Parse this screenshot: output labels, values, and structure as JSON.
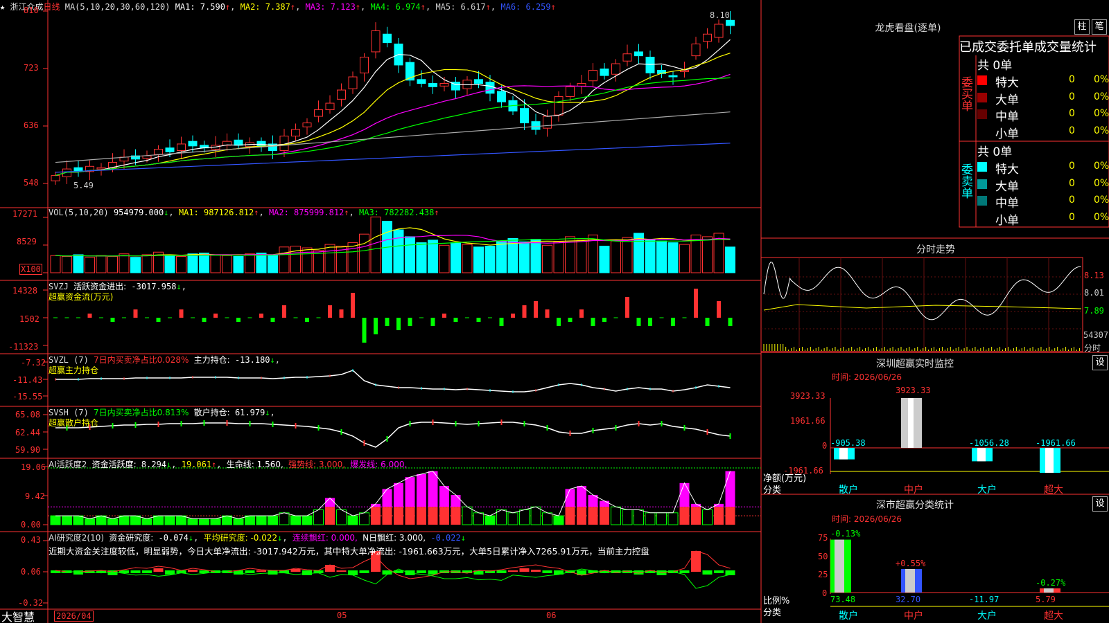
{
  "header": {
    "star": "★",
    "stock_name": "浙江众成",
    "period": "日线",
    "ma_label": "MA(5,10,20,30,60,120)",
    "ma1": "MA1: 7.590",
    "ma2": "MA2: 7.387",
    "ma3": "MA3: 7.123",
    "ma4": "MA4: 6.974",
    "ma5": "MA5: 6.617",
    "ma6": "MA6: 6.259",
    "arrow_up": "↑",
    "arrow_down": "↓"
  },
  "price_axis": [
    "810",
    "723",
    "636",
    "548"
  ],
  "price_annotations": {
    "high": "8.10",
    "low": "5.49"
  },
  "vol": {
    "label": "VOL(5,10,20)",
    "value": "954979.000",
    "ma1": "MA1: 987126.812",
    "ma2": "MA2: 875999.812",
    "ma3": "MA3: 782282.438",
    "axis": [
      "17271",
      "8529"
    ],
    "unit": "X100"
  },
  "svzj": {
    "label": "SVZJ",
    "name": "活跃资金进出:",
    "value": "-3017.958",
    "subtitle": "超赢资金流(万元)",
    "axis": [
      "14328",
      "1502",
      "-11323"
    ]
  },
  "svzl": {
    "label": "SVZL (7)",
    "desc": "7日内买卖净占比0.028%",
    "name": "主力持仓:",
    "value": "-13.180",
    "subtitle": "超赢主力持仓",
    "axis": [
      "-7.32",
      "-11.43",
      "-15.55"
    ]
  },
  "svsh": {
    "label": "SVSH (7)",
    "desc": "7日内买卖净占比0.813%",
    "name": "散户持仓:",
    "value": "61.979",
    "subtitle": "超赢散户持仓",
    "axis": [
      "65.08",
      "62.44",
      "59.90"
    ]
  },
  "ai1": {
    "label": "AI活跃度2",
    "name": "资金活跃度:",
    "value": "8.294",
    "value2": "19.061",
    "life": "生命线: 1.560,",
    "strong": "强势线: 3.000,",
    "burst": "爆发线: 6.000,",
    "axis": [
      "19.06",
      "9.42",
      "0.00"
    ]
  },
  "ai2": {
    "label": "AI研究度2(10)",
    "name": "资金研究度:",
    "value": "-0.074",
    "avg": "平均研究度: -0.022",
    "cont": "连续飘红: 0.000,",
    "nday": "N日飘红: 3.000,",
    "last": "-0.022",
    "text": "近期大资金关注度较低，明显弱势，今日大单净流出: -3017.942万元，其中特大单净流出: -1961.663万元，大单5日累计净入7265.91万元，当前主力控盘",
    "axis": [
      "0.43",
      "0.06",
      "-0.32"
    ]
  },
  "footer": {
    "brand": "大智慧",
    "date": "2026/04",
    "m05": "05",
    "m06": "06"
  },
  "dragon": {
    "title": "龙虎看盘(逐单)",
    "btn1": "柱",
    "btn2": "笔",
    "tabs": "已成交委托单成交量统计",
    "buy_label": "委买单",
    "sell_label": "委卖单",
    "buy_total": "共 0单",
    "sell_total": "共 0单",
    "buy_rows": [
      {
        "name": "特大",
        "count": "0",
        "pct": "0%",
        "color": "#ff0000"
      },
      {
        "name": "大单",
        "count": "0",
        "pct": "0%",
        "color": "#990000"
      },
      {
        "name": "中单",
        "count": "0",
        "pct": "0%",
        "color": "#660000"
      },
      {
        "name": "小单",
        "count": "0",
        "pct": "0%",
        "color": ""
      }
    ],
    "sell_rows": [
      {
        "name": "特大",
        "count": "0",
        "pct": "0%",
        "color": "#00ffff"
      },
      {
        "name": "大单",
        "count": "0",
        "pct": "0%",
        "color": "#009999"
      },
      {
        "name": "中单",
        "count": "0",
        "pct": "0%",
        "color": "#007777"
      },
      {
        "name": "小单",
        "count": "0",
        "pct": "0%",
        "color": ""
      }
    ]
  },
  "intraday": {
    "title": "分时走势",
    "prices": [
      "8.13",
      "8.01",
      "7.89"
    ],
    "vol": "54307",
    "vol_label": "分时"
  },
  "monitor": {
    "title": "深圳超赢实时监控",
    "btn": "设",
    "time": "时间: 2026/06/26",
    "axis": [
      "3923.33",
      "1961.66",
      "0",
      "-1961.66"
    ],
    "ylabel": "净额(万元)",
    "xlabel": "分类",
    "cats": [
      "散户",
      "中户",
      "大户",
      "超大"
    ],
    "values": [
      "-905.38",
      "3923.33",
      "-1056.28",
      "-1961.66"
    ]
  },
  "classify": {
    "title": "深市超赢分类统计",
    "btn": "设",
    "time": "时间: 2026/06/26",
    "axis": [
      "75",
      "50",
      "25",
      "0"
    ],
    "ylabel": "比例%",
    "xlabel": "分类",
    "cats": [
      "散户",
      "中户",
      "大户",
      "超大"
    ],
    "pcts": [
      "-0.13%",
      "+0.55%",
      "",
      "-0.27%"
    ],
    "values": [
      "73.48",
      "32.70",
      "-11.97",
      "5.79"
    ]
  }
}
